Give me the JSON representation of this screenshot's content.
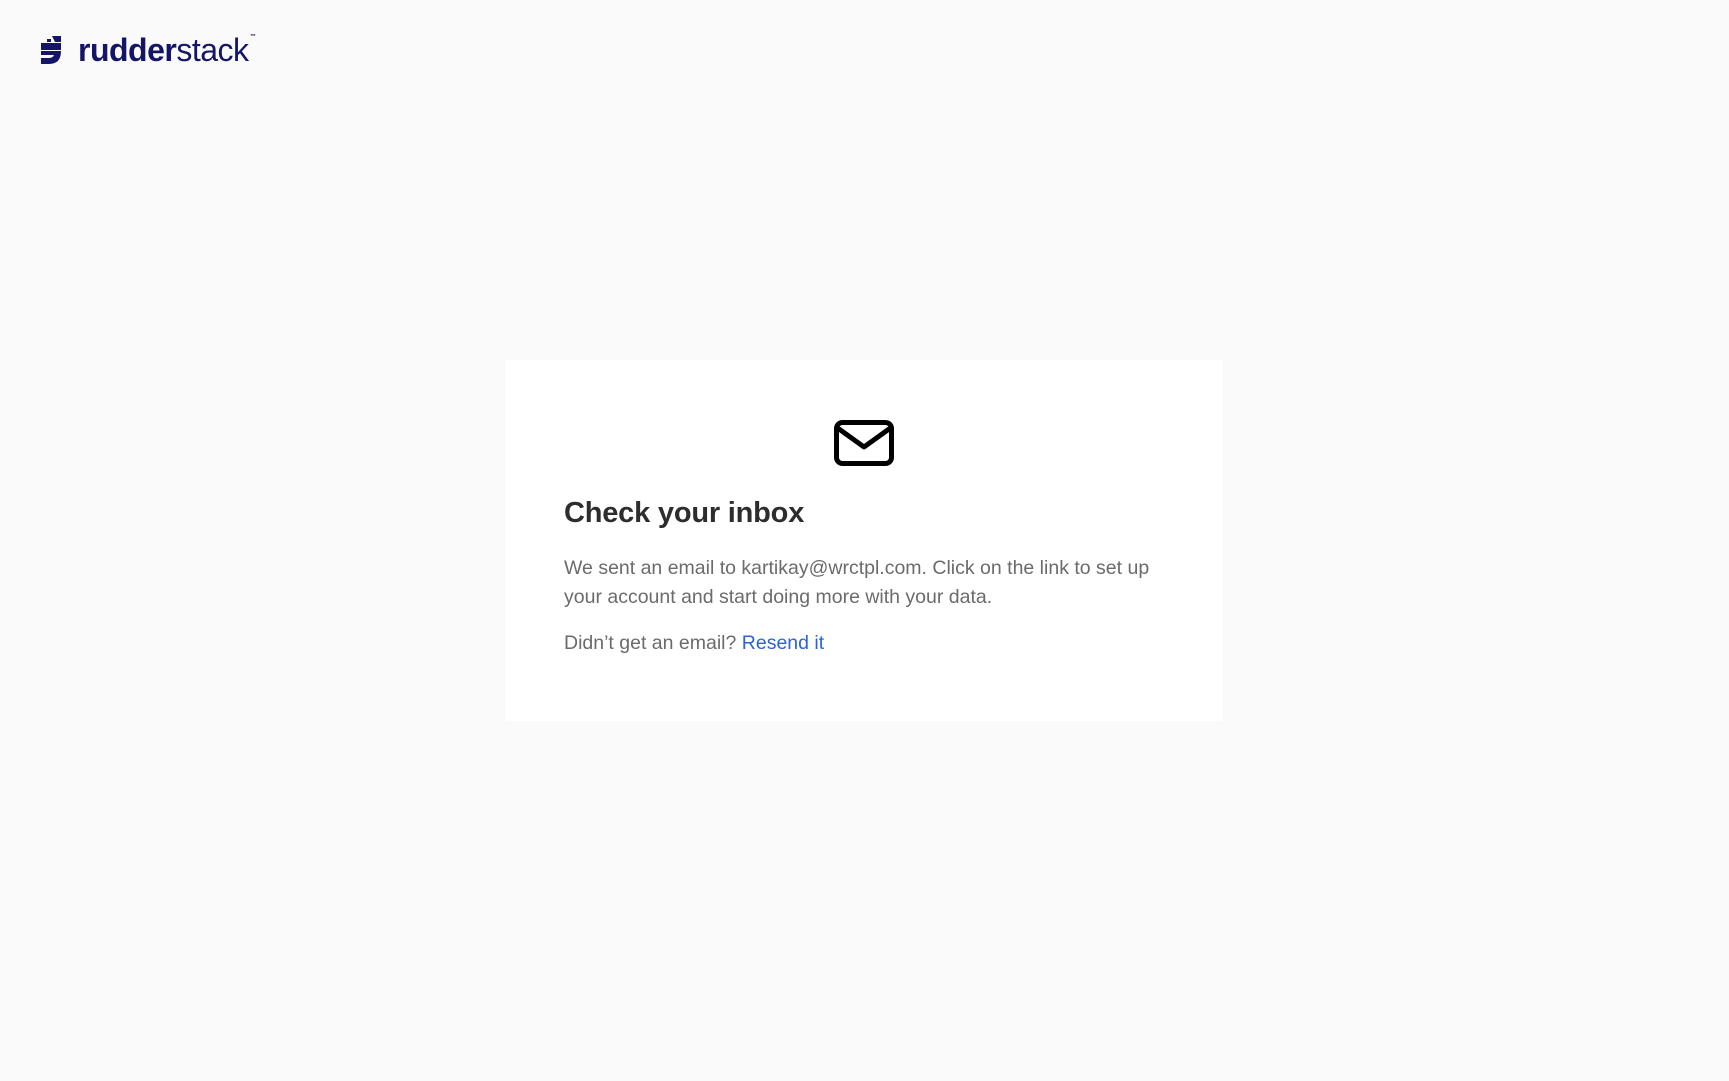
{
  "brand": {
    "name_bold": "rudder",
    "name_light": "stack",
    "trademark": "™",
    "logo_icon": "rudderstack-logo-icon",
    "color": "#141566"
  },
  "card": {
    "icon": "envelope-icon",
    "title": "Check your inbox",
    "message": "We sent an email to kartikay@wrctpl.com. Click on the link to set up your account and start doing more with your data.",
    "resend_prompt": "Didn’t get an email?",
    "resend_link": "Resend it",
    "link_color": "#2b63d9"
  }
}
